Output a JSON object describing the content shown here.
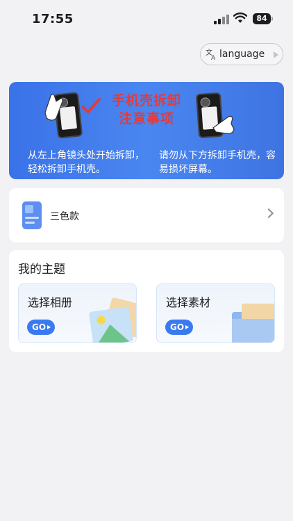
{
  "status_bar": {
    "time": "17:55",
    "battery": "84"
  },
  "language_button": {
    "label": "language"
  },
  "banner": {
    "title_line1": "手机壳拆卸",
    "title_line2": "注意事项",
    "left_text": "从左上角镜头处开始拆卸，轻松拆卸手机壳。",
    "right_text": "请勿从下方拆卸手机壳，容易损坏屏幕。"
  },
  "case_item": {
    "label": "三色款"
  },
  "my_theme": {
    "title": "我的主题",
    "tiles": [
      {
        "label": "选择相册",
        "go": "GO"
      },
      {
        "label": "选择素材",
        "go": "GO"
      }
    ]
  },
  "colors": {
    "accent": "#3a7af0",
    "banner": "#4a86f0",
    "warning": "#e53a3a"
  }
}
